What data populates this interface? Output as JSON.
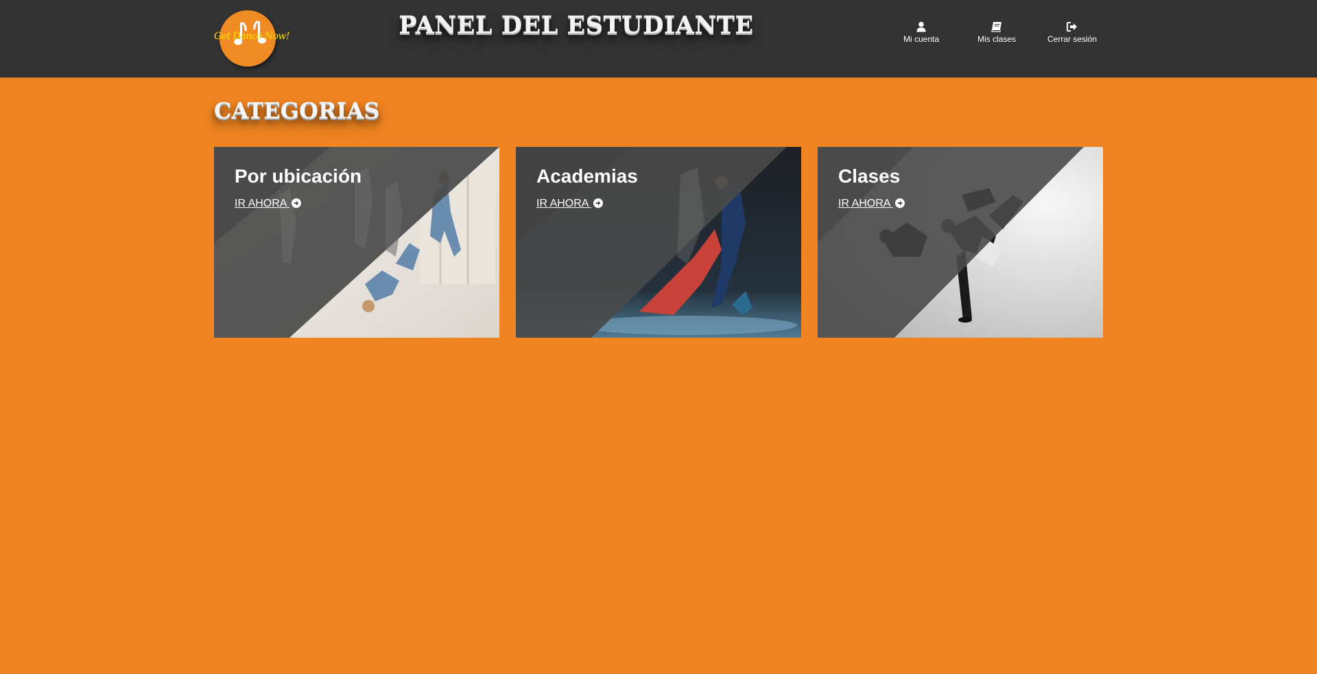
{
  "header": {
    "logo_text": "Get Dance Now!",
    "title": "PANEL DEL ESTUDIANTE",
    "nav": [
      {
        "label": "Mi cuenta",
        "icon": "user-icon"
      },
      {
        "label": "Mis clases",
        "icon": "book-icon"
      },
      {
        "label": "Cerrar sesión",
        "icon": "sign-out-icon"
      }
    ]
  },
  "main": {
    "section_title": "CATEGORIAS",
    "cards": [
      {
        "title": "Por ubicación",
        "link": "IR AHORA",
        "link_icon": "arrow-circle-right-icon"
      },
      {
        "title": "Academias",
        "link": "IR AHORA",
        "link_icon": "arrow-circle-right-icon"
      },
      {
        "title": "Clases",
        "link": "IR AHORA",
        "link_icon": "arrow-circle-right-icon"
      }
    ]
  },
  "colors": {
    "page_background": "#ef8421",
    "header_background": "#333333",
    "card_overlay": "#4a4a4a",
    "text": "#ffffff",
    "logo_text": "#ffe000"
  }
}
